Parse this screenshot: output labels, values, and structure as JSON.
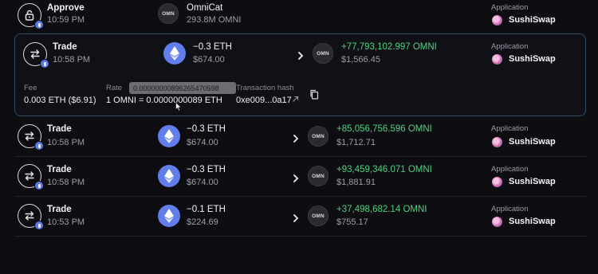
{
  "rows": [
    {
      "title": "Approve",
      "time": "10:59 PM",
      "token_icon": "OMN",
      "amount": "OmniCat",
      "sub": "293.8M OMNI",
      "app_label": "Application",
      "app_name": "SushiSwap"
    },
    {
      "title": "Trade",
      "time": "10:58 PM",
      "from_amount": "−0.3 ETH",
      "from_sub": "$674.00",
      "to_icon": "OMN",
      "to_amount": "+77,793,102.997 OMNI",
      "to_sub": "$1,566.45",
      "app_label": "Application",
      "app_name": "SushiSwap",
      "details": {
        "fee_label": "Fee",
        "fee_value": "0.003 ETH ($6.91)",
        "rate_label": "Rate",
        "rate_value": "1 OMNI = 0.0000000089 ETH",
        "rate_tooltip": "0.00000000896265470598",
        "hash_label": "Transaction hash",
        "hash_value": "0xe009...0a17"
      }
    },
    {
      "title": "Trade",
      "time": "10:58 PM",
      "from_amount": "−0.3 ETH",
      "from_sub": "$674.00",
      "to_icon": "OMN",
      "to_amount": "+85,056,756.596 OMNI",
      "to_sub": "$1,712.71",
      "app_label": "Application",
      "app_name": "SushiSwap"
    },
    {
      "title": "Trade",
      "time": "10:58 PM",
      "from_amount": "−0.3 ETH",
      "from_sub": "$674.00",
      "to_icon": "OMN",
      "to_amount": "+93,459,346.071 OMNI",
      "to_sub": "$1,881.91",
      "app_label": "Application",
      "app_name": "SushiSwap"
    },
    {
      "title": "Trade",
      "time": "10:53 PM",
      "from_amount": "−0.1 ETH",
      "from_sub": "$224.69",
      "to_icon": "OMN",
      "to_amount": "+37,498,682.14 OMNI",
      "to_sub": "$755.17",
      "app_label": "Application",
      "app_name": "SushiSwap"
    }
  ],
  "colors": {
    "positive": "#4fd082",
    "eth": "#627eea",
    "highlight_border": "#2f4f66"
  }
}
